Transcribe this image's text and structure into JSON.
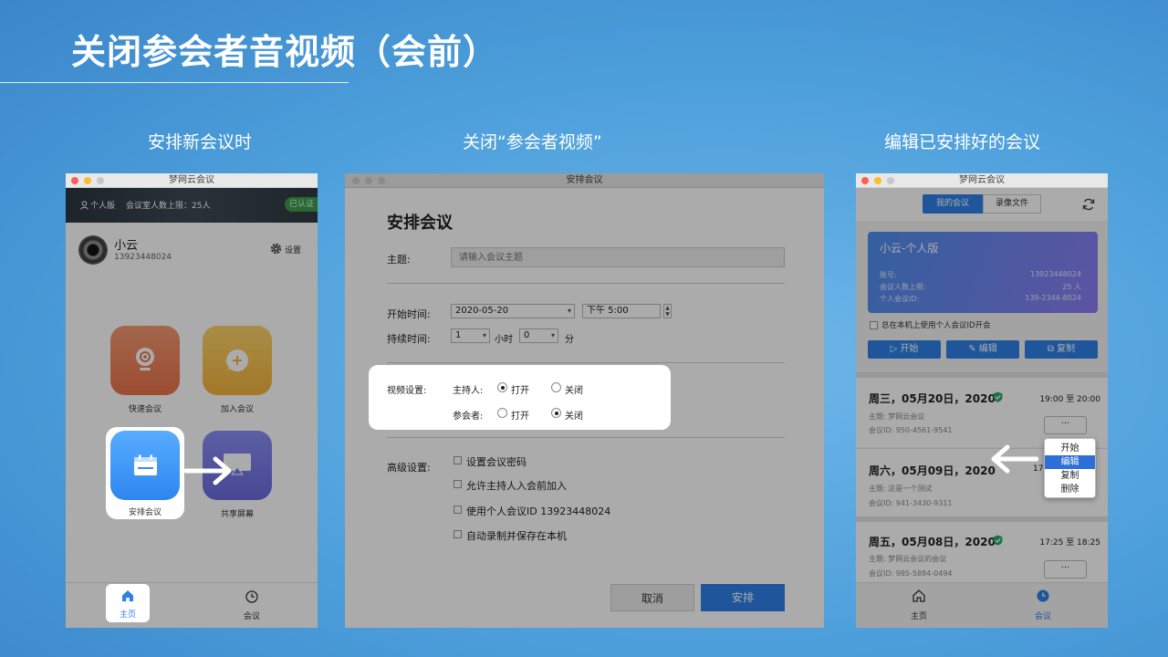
{
  "slide": {
    "title": "关闭参会者音视频（会前）",
    "captions": [
      "安排新会议时",
      "关闭“参会者视频”",
      "编辑已安排好的会议"
    ]
  },
  "app_main": {
    "window_title": "梦网云会议",
    "header": {
      "edition": "个人版",
      "capacity": "会议室人数上限：25人",
      "badge": "已认证"
    },
    "user": {
      "name": "小云",
      "phone": "13923448024"
    },
    "settings_label": "设置",
    "tiles": {
      "quick": "快速会议",
      "join": "加入会议",
      "schedule": "安排会议",
      "share": "共享屏幕"
    },
    "nav": {
      "home": "主页",
      "meetings": "会议"
    }
  },
  "schedule_dialog": {
    "window_title": "安排会议",
    "heading": "安排会议",
    "topic_label": "主题:",
    "topic_placeholder": "请输入会议主题",
    "start_label": "开始时间:",
    "start_date": "2020-05-20",
    "start_time": "下午  5:00",
    "duration_label": "持续时间:",
    "hours_value": "1",
    "hours_unit": "小时",
    "minutes_value": "0",
    "minutes_unit": "分",
    "video_label": "视频设置:",
    "host_label": "主持人:",
    "participant_label": "参会者:",
    "on_label": "打开",
    "off_label": "关闭",
    "host_video": "打开",
    "participant_video": "关闭",
    "advanced_label": "高级设置:",
    "options": [
      "设置会议密码",
      "允许主持人入会前加入",
      "使用个人会议ID  13923448024",
      "自动录制并保存在本机"
    ],
    "cancel_label": "取消",
    "submit_label": "安排"
  },
  "meetings_panel": {
    "window_title": "梦网云会议",
    "tabs": [
      "我的会议",
      "录像文件"
    ],
    "card": {
      "title": "小云-个人版",
      "rows": [
        {
          "label": "账号:",
          "value": "13923448024"
        },
        {
          "label": "会议人数上限:",
          "value": "25 人"
        },
        {
          "label": "个人会议ID:",
          "value": "139-2344-8024"
        }
      ]
    },
    "personal_id_checkbox": "总在本机上使用个人会议ID开会",
    "actions": {
      "start": "开始",
      "edit": "编辑",
      "copy": "复制"
    },
    "meetings": [
      {
        "date": "周三，05月20日，2020",
        "time": "19:00 至 20:00",
        "topic": "主题:  梦网云会议",
        "id": "会议ID:  950-4561-9541"
      },
      {
        "date": "周六，05月09日，2020",
        "time": "17:",
        "topic": "主题:  这是一个测试",
        "id": "会议ID:  941-3430-9311"
      },
      {
        "date": "周五，05月08日，2020",
        "time": "17:25 至 18:25",
        "topic": "主题:  梦网云会议的会议",
        "id": "会议ID:  985-5884-0494"
      }
    ],
    "more_label": "···",
    "context_menu": [
      "开始",
      "编辑",
      "复制",
      "删除"
    ],
    "context_menu_selected": "编辑",
    "nav": {
      "home": "主页",
      "meetings": "会议"
    }
  }
}
